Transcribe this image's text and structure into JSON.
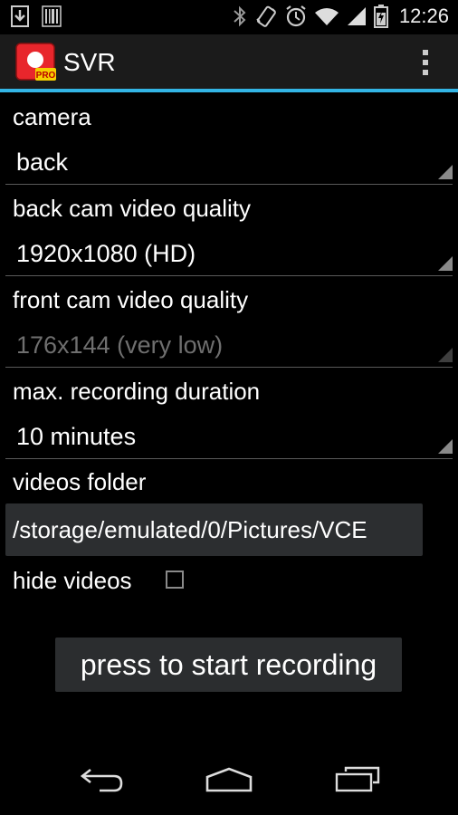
{
  "status_bar": {
    "time": "12:26"
  },
  "action_bar": {
    "title": "SVR",
    "icon_badge": "PRO"
  },
  "settings": {
    "camera_label": "camera",
    "camera_value": "back",
    "back_quality_label": "back cam video quality",
    "back_quality_value": "1920x1080 (HD)",
    "front_quality_label": "front cam video quality",
    "front_quality_value": "176x144 (very low)",
    "duration_label": "max. recording duration",
    "duration_value": "10 minutes",
    "folder_label": "videos folder",
    "folder_value": "/storage/emulated/0/Pictures/VCE",
    "hide_label": "hide videos",
    "hide_checked": false
  },
  "record_button": {
    "label": "press to start recording"
  },
  "colors": {
    "accent": "#33b5e5",
    "app_icon": "#e8262c",
    "badge": "#f5d000"
  }
}
